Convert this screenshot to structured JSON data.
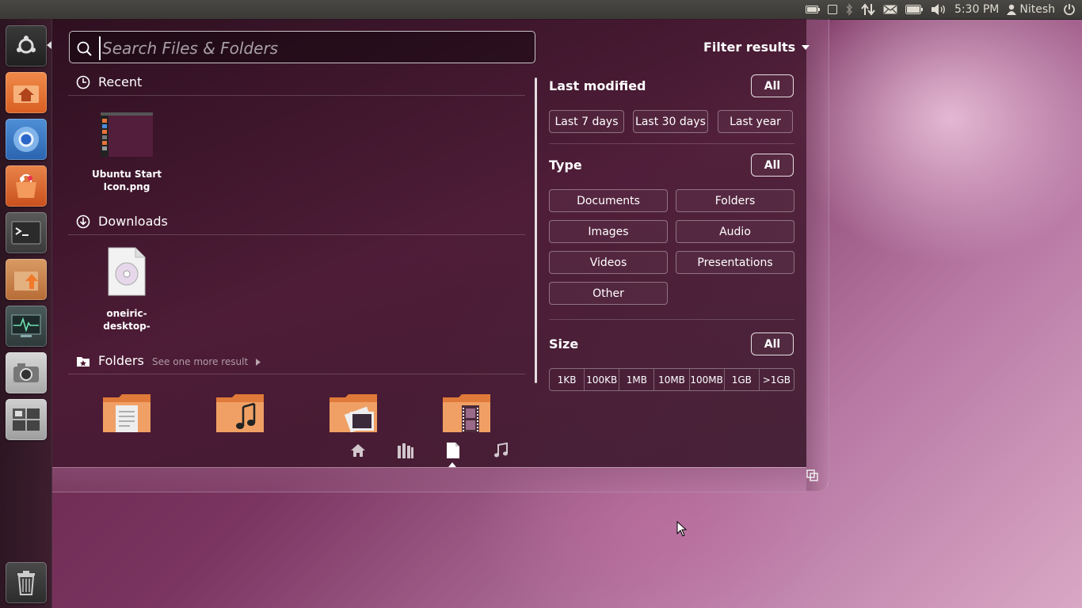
{
  "top_panel": {
    "clock": "5:30 PM",
    "user": "Nitesh",
    "indicators": [
      "battery-indicator-icon",
      "window-icon",
      "bluetooth-icon",
      "network-icon",
      "mail-icon",
      "battery-icon",
      "volume-icon",
      "user-icon",
      "power-icon"
    ]
  },
  "launcher": {
    "items": [
      "ubuntu-logo-icon",
      "home-folder-icon",
      "chromium-icon",
      "software-center-icon",
      "terminal-icon",
      "update-manager-icon",
      "system-monitor-icon",
      "camera-icon",
      "workspace-switcher-icon",
      "trash-icon"
    ]
  },
  "search": {
    "placeholder": "Search Files & Folders",
    "value": ""
  },
  "sections": {
    "recent": {
      "title": "Recent",
      "items": [
        {
          "label": "Ubuntu Start Icon.png"
        }
      ]
    },
    "downloads": {
      "title": "Downloads",
      "items": [
        {
          "label": "oneiric-desktop-"
        }
      ]
    },
    "folders": {
      "title": "Folders",
      "more": "See one more result",
      "items": [
        "documents-folder-icon",
        "music-folder-icon",
        "pictures-folder-icon",
        "videos-folder-icon"
      ]
    }
  },
  "filter": {
    "toggle_label": "Filter results",
    "last_modified": {
      "title": "Last modified",
      "all_label": "All",
      "options": [
        "Last 7 days",
        "Last 30 days",
        "Last year"
      ]
    },
    "type": {
      "title": "Type",
      "all_label": "All",
      "options": [
        "Documents",
        "Folders",
        "Images",
        "Audio",
        "Videos",
        "Presentations",
        "Other"
      ]
    },
    "size": {
      "title": "Size",
      "all_label": "All",
      "options": [
        "1KB",
        "100KB",
        "1MB",
        "10MB",
        "100MB",
        "1GB",
        ">1GB"
      ]
    }
  },
  "lens_bar": {
    "items": [
      "home-lens-icon",
      "applications-lens-icon",
      "files-lens-icon",
      "music-lens-icon"
    ],
    "active": "files-lens-icon"
  },
  "colors": {
    "launcher_orange": "#e8733a",
    "panel_bg": "#3c3b37"
  }
}
